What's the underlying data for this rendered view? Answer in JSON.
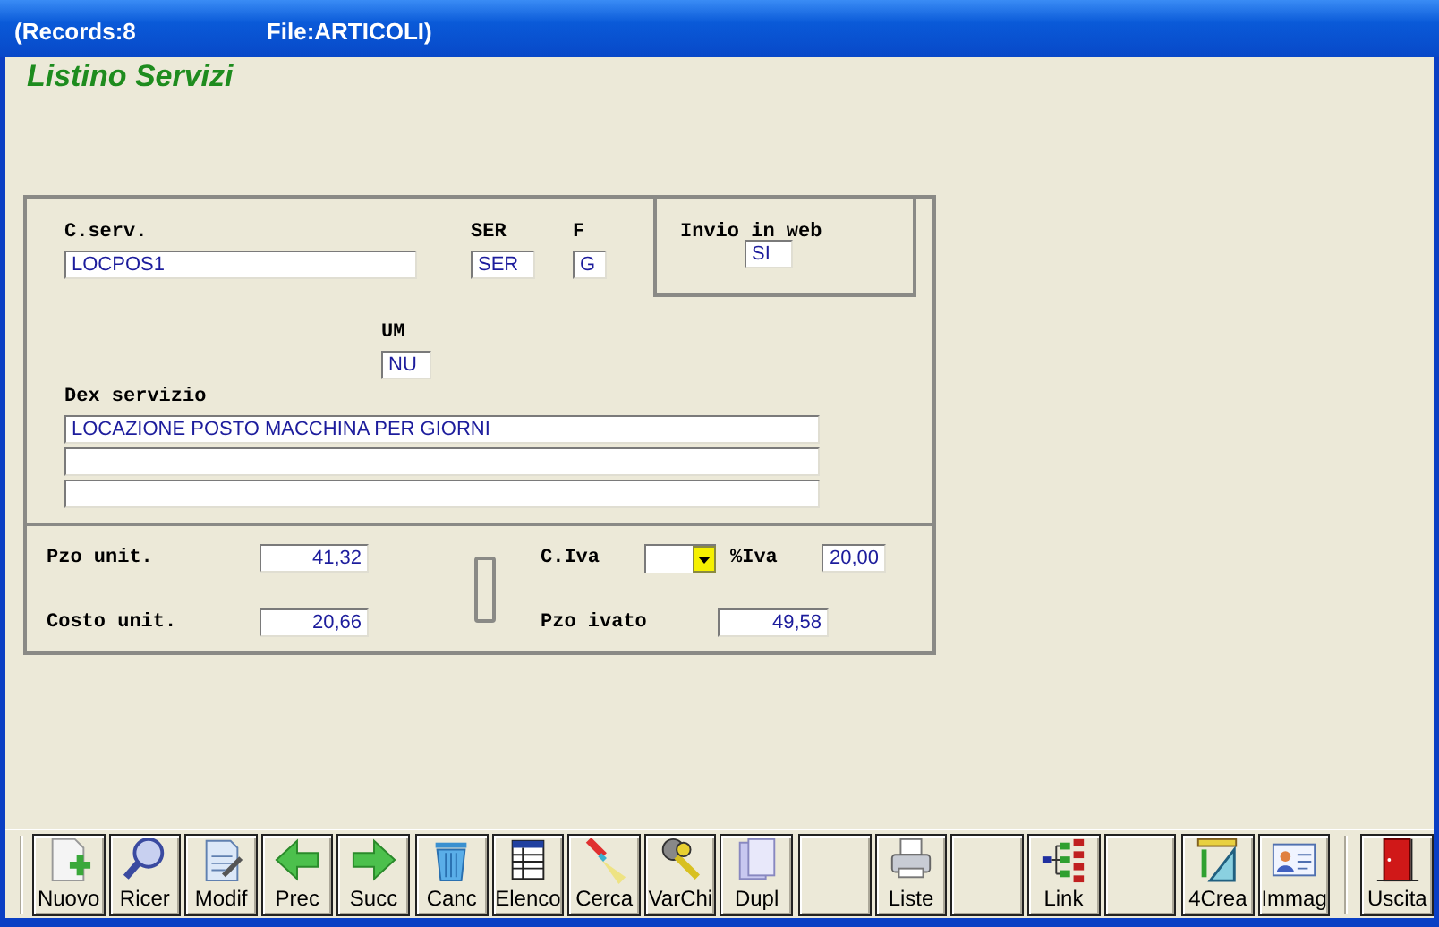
{
  "window": {
    "records": "(Records:8",
    "file": "File:ARTICOLI)"
  },
  "heading": "Listino Servizi",
  "form": {
    "code": {
      "label": "C.serv.",
      "value": "LOCPOS1"
    },
    "ser": {
      "label": "SER",
      "value": "SER"
    },
    "f": {
      "label": "F",
      "value": "G"
    },
    "web": {
      "label": "Invio in web",
      "value": "SI"
    },
    "um": {
      "label": "UM",
      "value": "NU"
    },
    "description": {
      "label": "Dex servizio",
      "lines": [
        "LOCAZIONE POSTO MACCHINA PER GIORNI"
      ]
    },
    "unit_price": {
      "label": "Pzo unit.",
      "value": "41,32"
    },
    "unit_cost": {
      "label": "Costo unit.",
      "value": "20,66"
    },
    "vat_code": {
      "label": "C.Iva"
    },
    "vat_rate": {
      "label": "%Iva",
      "value": "20,00"
    },
    "price_with_vat": {
      "label": "Pzo ivato",
      "value": "49,58"
    }
  },
  "toolbar": [
    {
      "kind": "new",
      "label": "Nuovo"
    },
    {
      "kind": "search",
      "label": "Ricer"
    },
    {
      "kind": "edit",
      "label": "Modif"
    },
    {
      "kind": "prev",
      "label": "Prec"
    },
    {
      "kind": "next",
      "label": "Succ"
    },
    {
      "kind": "delete",
      "label": "Canc"
    },
    {
      "kind": "list",
      "label": "Elenco"
    },
    {
      "kind": "find",
      "label": "Cerca"
    },
    {
      "kind": "keys",
      "label": "VarChi"
    },
    {
      "kind": "copy",
      "label": "Dupl"
    },
    {
      "kind": "blank"
    },
    {
      "kind": "print",
      "label": "Liste"
    },
    {
      "kind": "blank"
    },
    {
      "kind": "link",
      "label": "Link"
    },
    {
      "kind": "blank"
    },
    {
      "kind": "tools",
      "label": "4Crea"
    },
    {
      "kind": "card",
      "label": "Immag"
    },
    {
      "kind": "exit",
      "label": "Uscita"
    }
  ]
}
